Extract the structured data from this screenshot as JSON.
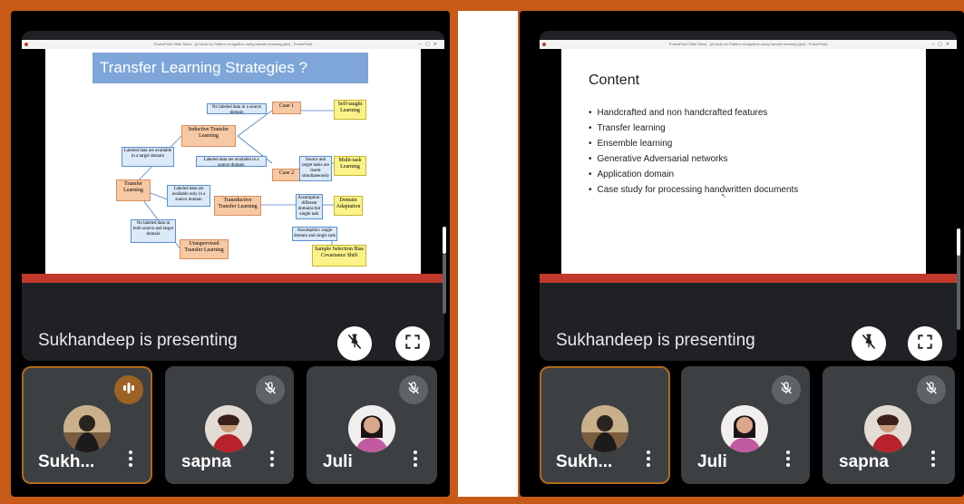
{
  "left": {
    "slide": {
      "window_title": "PowerPoint Slide Show - [AI tools for Pattern recognition using transfer learning.pptx] - PowerPoint",
      "title": "Transfer Learning Strategies ?",
      "diagram": {
        "transfer_learning": "Transfer Learning",
        "inductive": "Inductive Transfer Learning",
        "transductive": "Transductive Transfer Learning",
        "unsupervised": "Unsupervised Transfer Learning",
        "case1": "Case 1",
        "case2": "Case 2",
        "self_taught": "Self-taught Learning",
        "multitask": "Multi-task Learning",
        "domain_adaptation": "Domain Adaptation",
        "sample_selection": "Sample Selection Bias Covariance Shift",
        "labeled_target": "Labeled data are available in a target domain",
        "labeled_target_only": "Labeled data are available only in a source domain",
        "no_labeled_both": "No labeled data in both source and target domain",
        "no_labeled_source": "No labeled data in a source domain",
        "labeled_source_avail": "Labeled data are available in a source domain",
        "source_target_simultaneous": "Source and target tasks are learnt simultaneously",
        "assumption_different": "Assumption: different domains but single task",
        "assumption_single": "Assumption: single domain and single task"
      }
    },
    "presenting_text": "Sukhandeep is presenting",
    "tiles": [
      {
        "name": "Sukh...",
        "active": true
      },
      {
        "name": "sapna",
        "active": false
      },
      {
        "name": "Juli",
        "active": false
      }
    ]
  },
  "right": {
    "slide": {
      "window_title": "PowerPoint Slide Show - [AI tools for Pattern recognition using transfer learning.pptx] - PowerPoint",
      "title": "Content",
      "bullets": [
        "Handcrafted and non handcrafted features",
        "Transfer learning",
        "Ensemble learning",
        "Generative Adversarial networks",
        "Application domain",
        "Case study for processing handwritten documents"
      ]
    },
    "presenting_text": "Sukhandeep is presenting",
    "tiles": [
      {
        "name": "Sukh...",
        "active": true
      },
      {
        "name": "Juli",
        "active": false
      },
      {
        "name": "sapna",
        "active": false
      }
    ]
  },
  "colors": {
    "frame": "#c85a17",
    "tile_bg": "#3c4043",
    "card_bg": "#202124",
    "speaking": "#9d6224",
    "slide_banner": "#7ea6d8"
  },
  "icons": {
    "unpin": "pin-off-icon",
    "fullscreen": "fullscreen-icon",
    "mic_off": "mic-off-icon",
    "speaking": "audio-level-icon",
    "more": "more-vert-icon"
  }
}
